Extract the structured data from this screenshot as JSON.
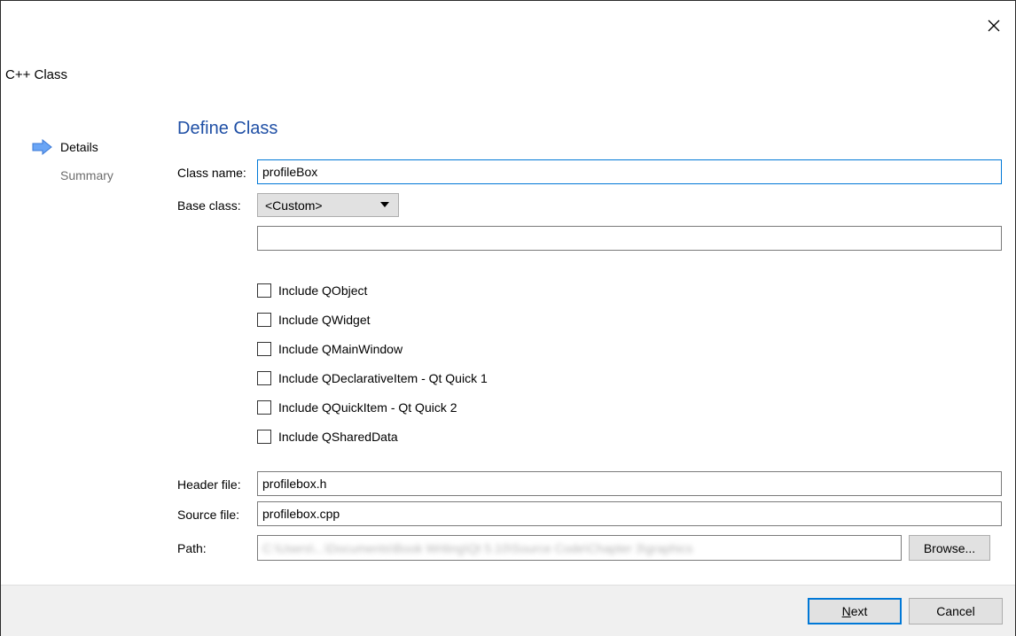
{
  "window": {
    "title": "C++ Class",
    "close_glyph": "✕"
  },
  "steps": [
    {
      "label": "Details",
      "active": true
    },
    {
      "label": "Summary",
      "active": false
    }
  ],
  "page": {
    "heading": "Define Class"
  },
  "form": {
    "class_name_label": "Class name:",
    "class_name_value": "profileBox",
    "base_class_label": "Base class:",
    "base_class_selected": "<Custom>",
    "custom_base_value": "",
    "checkboxes": [
      {
        "label": "Include QObject",
        "checked": false
      },
      {
        "label": "Include QWidget",
        "checked": false
      },
      {
        "label": "Include QMainWindow",
        "checked": false
      },
      {
        "label": "Include QDeclarativeItem - Qt Quick 1",
        "checked": false
      },
      {
        "label": "Include QQuickItem - Qt Quick 2",
        "checked": false
      },
      {
        "label": "Include QSharedData",
        "checked": false
      }
    ],
    "header_file_label": "Header file:",
    "header_file_value": "profilebox.h",
    "source_file_label": "Source file:",
    "source_file_value": "profilebox.cpp",
    "path_label": "Path:",
    "path_value": "C:\\Users\\...\\Documents\\Book Writing\\Qt 5.10\\Source Code\\Chapter 3\\graphics",
    "browse_label": "Browse..."
  },
  "footer": {
    "next_mnemonic": "N",
    "next_rest": "ext",
    "cancel_label": "Cancel"
  },
  "colors": {
    "heading": "#1f4fa5",
    "focus_border": "#0078d7",
    "step_arrow": "#6aa5f5"
  }
}
